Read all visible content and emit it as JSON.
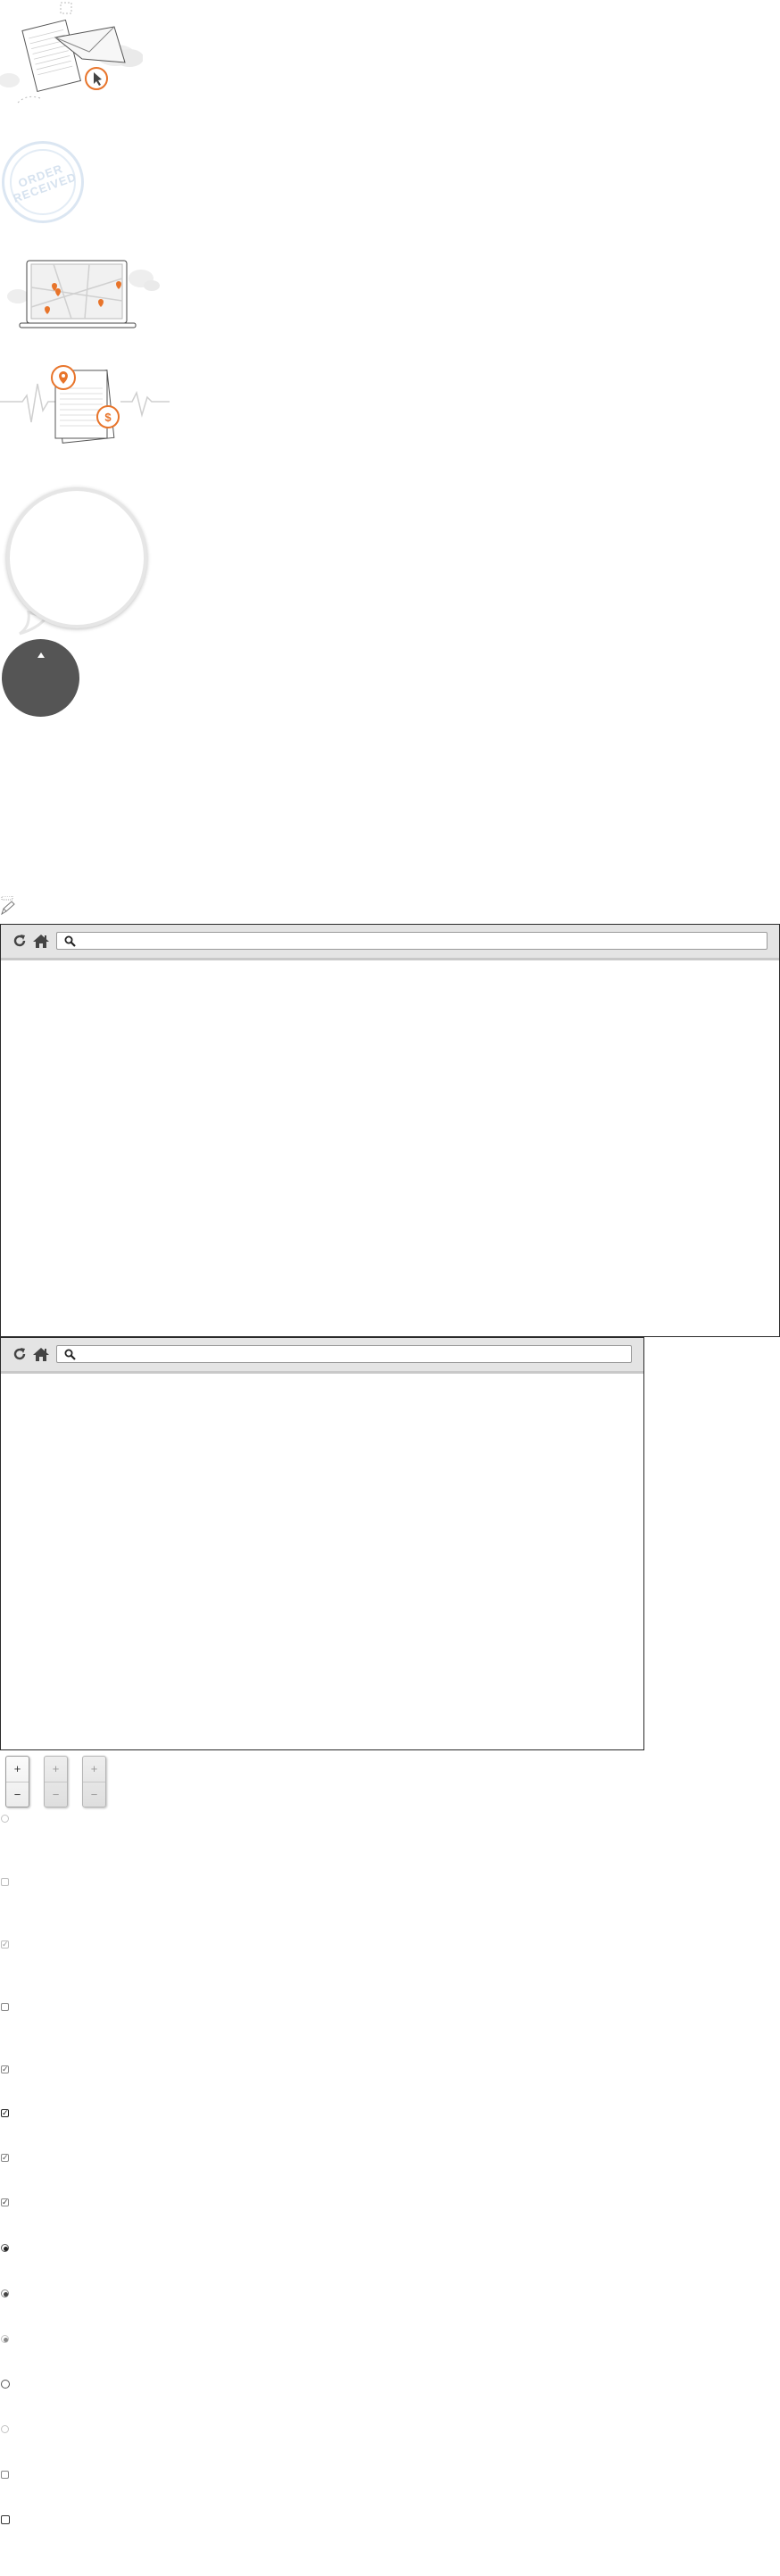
{
  "illustrations": {
    "stamp_text": "ORDER RECEIVED",
    "price_symbol": "$",
    "accent_color": "#e8742a"
  },
  "browser_large": {
    "address_value": "",
    "address_placeholder": ""
  },
  "browser_small": {
    "address_value": "",
    "address_placeholder": ""
  },
  "zoom_controls": [
    {
      "plus": "+",
      "minus": "−",
      "state": "enabled"
    },
    {
      "plus": "+",
      "minus": "−",
      "state": "disabled"
    },
    {
      "plus": "+",
      "minus": "−",
      "state": "disabled"
    }
  ],
  "form_controls": {
    "checkmark": "✓",
    "types": [
      "radio",
      "checkbox",
      "checkbox-checked",
      "checkbox",
      "checkbox-checked",
      "checkbox-checked",
      "checkbox-checked",
      "checkbox-checked",
      "radio-selected",
      "radio-selected",
      "radio-selected",
      "radio",
      "radio",
      "checkbox",
      "checkbox"
    ]
  },
  "colors": {
    "accent": "#e8742a",
    "browser_bar": "#e4e4e4",
    "dark_circle": "#555555",
    "stamp": "#dbe6f2"
  }
}
